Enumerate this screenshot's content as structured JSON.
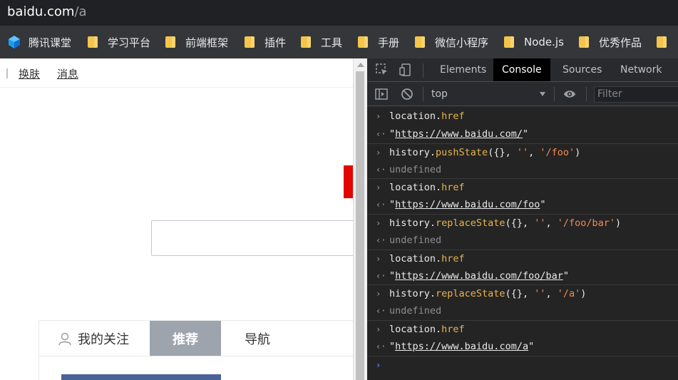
{
  "address_bar": {
    "host": "baidu.com",
    "path": "/a"
  },
  "bookmarks": [
    {
      "label": "腾讯课堂",
      "icon": "tencent-classroom-icon"
    },
    {
      "label": "学习平台",
      "icon": "folder-icon"
    },
    {
      "label": "前端框架",
      "icon": "folder-icon"
    },
    {
      "label": "插件",
      "icon": "folder-icon"
    },
    {
      "label": "工具",
      "icon": "folder-icon"
    },
    {
      "label": "手册",
      "icon": "folder-icon"
    },
    {
      "label": "微信小程序",
      "icon": "folder-icon"
    },
    {
      "label": "Node.js",
      "icon": "folder-icon"
    },
    {
      "label": "优秀作品",
      "icon": "folder-icon"
    }
  ],
  "webpage": {
    "separator": "|",
    "links": [
      "换肤",
      "消息"
    ],
    "tabs": [
      "我的关注",
      "推荐",
      "导航"
    ],
    "active_tab": "推荐",
    "accent_color": "#e10601"
  },
  "devtools": {
    "tabs": [
      "Elements",
      "Console",
      "Sources",
      "Network"
    ],
    "active_tab": "Console",
    "context": "top",
    "filter_placeholder": "Filter",
    "colors": {
      "property": "#e8b44d",
      "string": "#f28b54",
      "input_prompt": "#4e95f0"
    },
    "console": [
      {
        "kind": "input",
        "obj": "location.",
        "prop": "href"
      },
      {
        "kind": "output",
        "q1": "\"",
        "url": "https://www.baidu.com/",
        "q2": "\""
      },
      {
        "kind": "input",
        "obj": "history.",
        "prop": "pushState",
        "args": [
          "({}, ",
          "''",
          ", ",
          "'/foo'",
          ")"
        ]
      },
      {
        "kind": "undefined",
        "text": "undefined"
      },
      {
        "kind": "input",
        "obj": "location.",
        "prop": "href"
      },
      {
        "kind": "output",
        "q1": "\"",
        "url": "https://www.baidu.com/foo",
        "q2": "\""
      },
      {
        "kind": "input",
        "obj": "history.",
        "prop": "replaceState",
        "args": [
          "({}, ",
          "''",
          ", ",
          "'/foo/bar'",
          ")"
        ]
      },
      {
        "kind": "undefined",
        "text": "undefined"
      },
      {
        "kind": "input",
        "obj": "location.",
        "prop": "href"
      },
      {
        "kind": "output",
        "q1": "\"",
        "url": "https://www.baidu.com/foo/bar",
        "q2": "\""
      },
      {
        "kind": "input",
        "obj": "history.",
        "prop": "replaceState",
        "args": [
          "({}, ",
          "''",
          ", ",
          "'/a'",
          ")"
        ]
      },
      {
        "kind": "undefined",
        "text": "undefined"
      },
      {
        "kind": "input",
        "obj": "location.",
        "prop": "href"
      },
      {
        "kind": "output",
        "q1": "\"",
        "url": "https://www.baidu.com/a",
        "q2": "\""
      }
    ],
    "prompt_input": "›",
    "prompt_output": "‹·"
  }
}
